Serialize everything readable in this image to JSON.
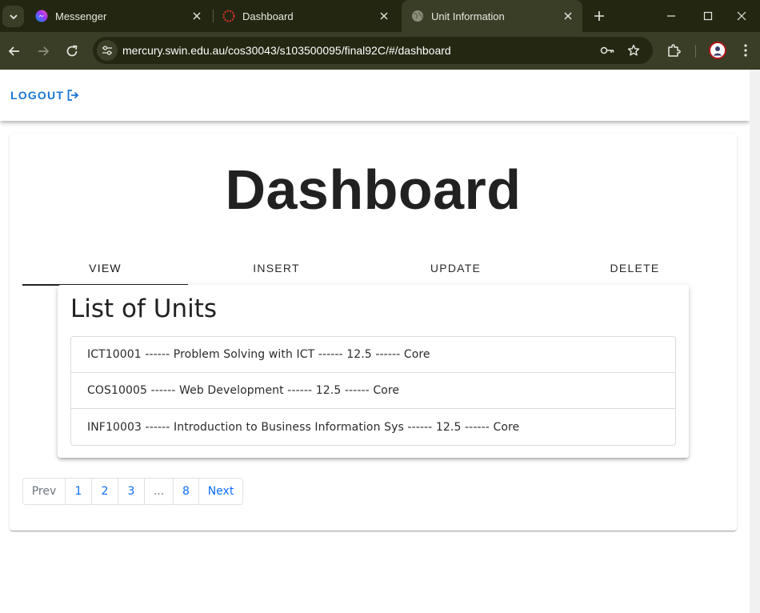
{
  "browser": {
    "tabs": [
      {
        "title": "Messenger",
        "icon": "messenger-icon"
      },
      {
        "title": "Dashboard",
        "icon": "swinburne-icon"
      },
      {
        "title": "Unit Information",
        "icon": "globe-icon",
        "active": true
      }
    ],
    "url": "mercury.swin.edu.au/cos30043/s103500095/final92C/#/dashboard",
    "accent": "#3a3e27"
  },
  "appbar": {
    "logout_label": "LOGOUT"
  },
  "page": {
    "title": "Dashboard",
    "tabs": [
      {
        "label": "VIEW",
        "active": true
      },
      {
        "label": "INSERT"
      },
      {
        "label": "UPDATE"
      },
      {
        "label": "DELETE"
      }
    ],
    "list_title": "List of Units",
    "units": [
      "ICT10001 ------ Problem Solving with ICT ------ 12.5 ------ Core",
      "COS10005 ------ Web Development ------ 12.5 ------ Core",
      "INF10003 ------ Introduction to Business Information Sys ------ 12.5 ------ Core"
    ],
    "pagination": {
      "prev": "Prev",
      "pages": [
        "1",
        "2",
        "3",
        "...",
        "8"
      ],
      "next": "Next"
    }
  },
  "colors": {
    "link": "#1976d2",
    "pagination_link": "#0d6efd"
  }
}
